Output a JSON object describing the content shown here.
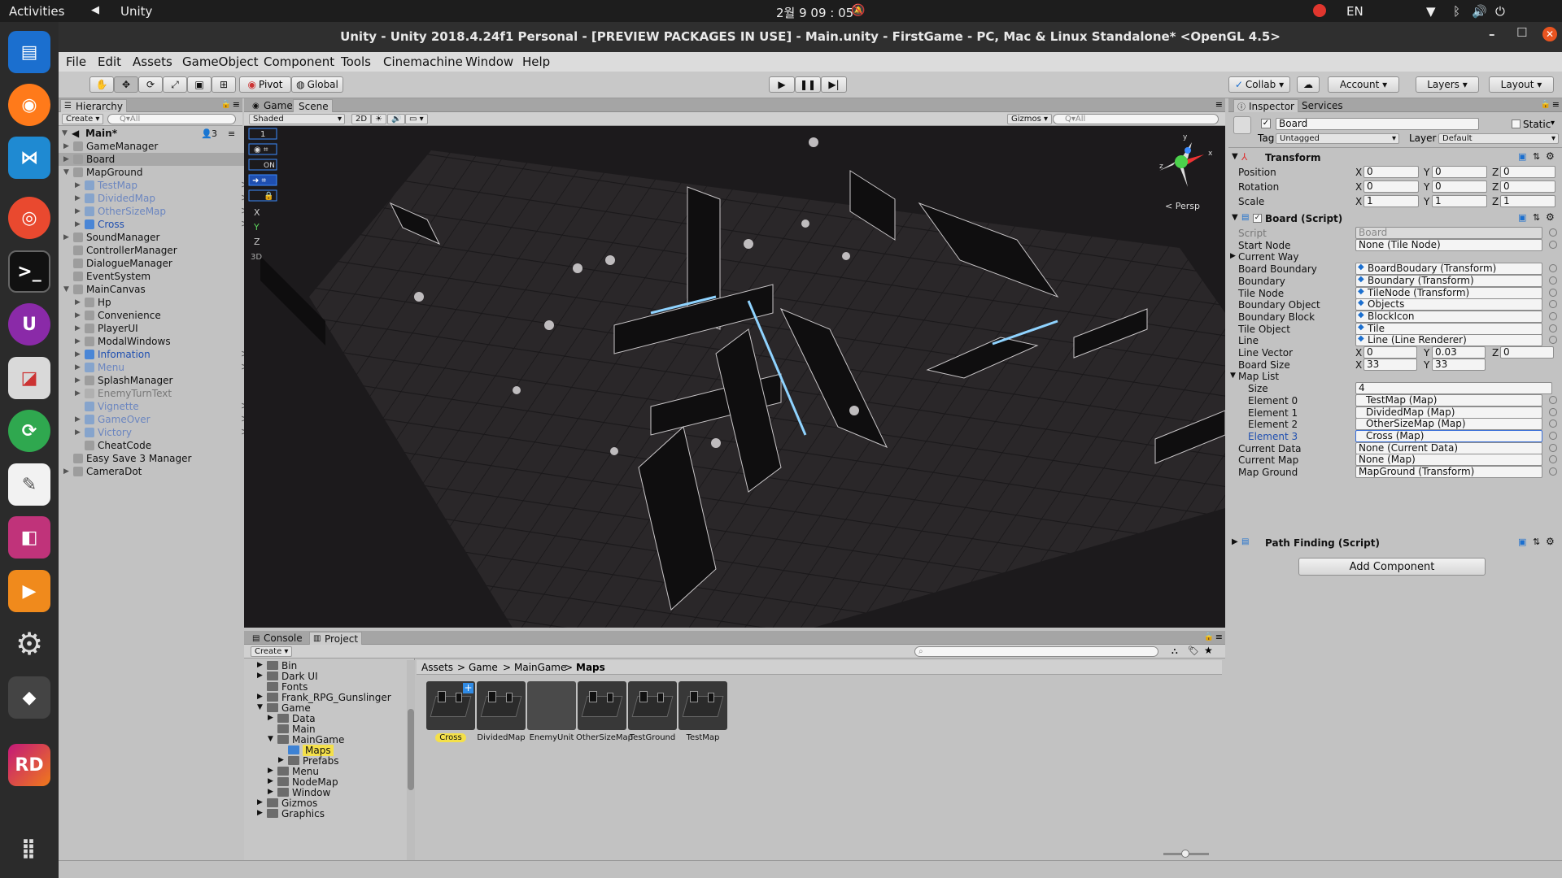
{
  "topbar": {
    "activities": "Activities",
    "app": "Unity",
    "clock": "2월 9  09 : 05",
    "lang": "EN"
  },
  "window": {
    "title": "Unity - Unity 2018.4.24f1 Personal - [PREVIEW PACKAGES IN USE] - Main.unity - FirstGame - PC, Mac & Linux Standalone* <OpenGL 4.5>"
  },
  "menu": [
    "File",
    "Edit",
    "Assets",
    "GameObject",
    "Component",
    "Tools",
    "Cinemachine",
    "Window",
    "Help"
  ],
  "toolbar": {
    "pivot": "Pivot",
    "global": "Global",
    "collab": "Collab",
    "account": "Account",
    "layers": "Layers",
    "layout": "Layout"
  },
  "hierarchy": {
    "tab": "Hierarchy",
    "create": "Create",
    "search_placeholder": "Q▾All",
    "scene": "Main*",
    "badge": "3",
    "items": [
      {
        "label": "GameManager",
        "depth": 0,
        "arrow": "right",
        "style": "normal"
      },
      {
        "label": "Board",
        "depth": 0,
        "arrow": "right",
        "style": "normal"
      },
      {
        "label": "MapGround",
        "depth": 0,
        "arrow": "down",
        "style": "normal"
      },
      {
        "label": "TestMap",
        "depth": 1,
        "arrow": "right",
        "style": "dim",
        "sub": ">"
      },
      {
        "label": "DividedMap",
        "depth": 1,
        "arrow": "right",
        "style": "dim",
        "sub": ">"
      },
      {
        "label": "OtherSizeMap",
        "depth": 1,
        "arrow": "right",
        "style": "dim",
        "sub": ">"
      },
      {
        "label": "Cross",
        "depth": 1,
        "arrow": "right",
        "style": "prefab",
        "sub": ">"
      },
      {
        "label": "SoundManager",
        "depth": 0,
        "arrow": "right",
        "style": "normal"
      },
      {
        "label": "ControllerManager",
        "depth": 0,
        "arrow": "",
        "style": "normal"
      },
      {
        "label": "DialogueManager",
        "depth": 0,
        "arrow": "",
        "style": "normal"
      },
      {
        "label": "EventSystem",
        "depth": 0,
        "arrow": "",
        "style": "normal"
      },
      {
        "label": "MainCanvas",
        "depth": 0,
        "arrow": "down",
        "style": "normal"
      },
      {
        "label": "Hp",
        "depth": 1,
        "arrow": "right",
        "style": "normal"
      },
      {
        "label": "Convenience",
        "depth": 1,
        "arrow": "right",
        "style": "normal"
      },
      {
        "label": "PlayerUI",
        "depth": 1,
        "arrow": "right",
        "style": "normal"
      },
      {
        "label": "ModalWindows",
        "depth": 1,
        "arrow": "right",
        "style": "normal"
      },
      {
        "label": "Infomation",
        "depth": 1,
        "arrow": "right",
        "style": "prefab",
        "sub": ">"
      },
      {
        "label": "Menu",
        "depth": 1,
        "arrow": "right",
        "style": "dim",
        "sub": ">"
      },
      {
        "label": "SplashManager",
        "depth": 1,
        "arrow": "right",
        "style": "normal"
      },
      {
        "label": "EnemyTurnText",
        "depth": 1,
        "arrow": "right",
        "style": "grey"
      },
      {
        "label": "Vignette",
        "depth": 1,
        "arrow": "",
        "style": "dim",
        "sub": ">"
      },
      {
        "label": "GameOver",
        "depth": 1,
        "arrow": "right",
        "style": "dim",
        "sub": ">"
      },
      {
        "label": "Victory",
        "depth": 1,
        "arrow": "right",
        "style": "dim",
        "sub": ">"
      },
      {
        "label": "CheatCode",
        "depth": 1,
        "arrow": "",
        "style": "normal"
      },
      {
        "label": "Easy Save 3 Manager",
        "depth": 0,
        "arrow": "",
        "style": "normal"
      },
      {
        "label": "CameraDot",
        "depth": 0,
        "arrow": "right",
        "style": "normal"
      }
    ]
  },
  "scene": {
    "tab_game": "Game",
    "tab_scene": "Scene",
    "shaded": "Shaded",
    "mode2d": "2D",
    "gizmos": "Gizmos",
    "search_placeholder": "Q▾All",
    "persp": "< Persp",
    "overlay": {
      "num": "1",
      "on": "ON",
      "x": "X",
      "y": "Y",
      "z": "Z",
      "d3": "3D"
    },
    "gizmo": {
      "x": "x",
      "y": "y",
      "z": "z"
    }
  },
  "inspector": {
    "tab": "Inspector",
    "services": "Services",
    "object_name": "Board",
    "static": "Static",
    "tag_label": "Tag",
    "tag_value": "Untagged",
    "layer_label": "Layer",
    "layer_value": "Default",
    "transform": {
      "title": "Transform",
      "position": "Position",
      "rotation": "Rotation",
      "scale": "Scale",
      "pos": [
        "0",
        "0",
        "0"
      ],
      "rot": [
        "0",
        "0",
        "0"
      ],
      "scl": [
        "1",
        "1",
        "1"
      ]
    },
    "board": {
      "title": "Board (Script)",
      "rows": [
        {
          "k": "Script",
          "v": "Board",
          "type": "script"
        },
        {
          "k": "Start Node",
          "v": "None (Tile Node)",
          "type": "obj"
        },
        {
          "k": "Current Way",
          "v": "",
          "type": "fold"
        },
        {
          "k": "Board Boundary",
          "v": "BoardBoudary (Transform)",
          "type": "ref"
        },
        {
          "k": "Boundary",
          "v": "Boundary (Transform)",
          "type": "ref"
        },
        {
          "k": "Tile Node",
          "v": "TileNode (Transform)",
          "type": "ref"
        },
        {
          "k": "Boundary Object",
          "v": "Objects",
          "type": "ref"
        },
        {
          "k": "Boundary Block",
          "v": "BlockIcon",
          "type": "ref"
        },
        {
          "k": "Tile Object",
          "v": "Tile",
          "type": "ref"
        },
        {
          "k": "Line",
          "v": "Line (Line Renderer)",
          "type": "ref"
        }
      ],
      "line_vector": {
        "k": "Line Vector",
        "x": "0",
        "y": "0.03",
        "z": "0"
      },
      "board_size": {
        "k": "Board Size",
        "x": "33",
        "y": "33"
      },
      "map_list": {
        "k": "Map List",
        "size_k": "Size",
        "size_v": "4",
        "elements": [
          {
            "k": "Element 0",
            "v": "TestMap (Map)"
          },
          {
            "k": "Element 1",
            "v": "DividedMap (Map)"
          },
          {
            "k": "Element 2",
            "v": "OtherSizeMap (Map)"
          },
          {
            "k": "Element 3",
            "v": "Cross (Map)"
          }
        ]
      },
      "tail": [
        {
          "k": "Current Data",
          "v": "None (Current Data)"
        },
        {
          "k": "Current Map",
          "v": "None (Map)"
        },
        {
          "k": "Map Ground",
          "v": "MapGround (Transform)"
        }
      ]
    },
    "pathfinding": "Path Finding (Script)",
    "add_component": "Add Component"
  },
  "bottom": {
    "tab_console": "Console",
    "tab_project": "Project",
    "create": "Create",
    "tree": [
      {
        "label": "Bin",
        "depth": 0,
        "arrow": "right"
      },
      {
        "label": "Dark UI",
        "depth": 0,
        "arrow": "right"
      },
      {
        "label": "Fonts",
        "depth": 0,
        "arrow": ""
      },
      {
        "label": "Frank_RPG_Gunslinger",
        "depth": 0,
        "arrow": "right"
      },
      {
        "label": "Game",
        "depth": 0,
        "arrow": "down"
      },
      {
        "label": "Data",
        "depth": 1,
        "arrow": "right"
      },
      {
        "label": "Main",
        "depth": 1,
        "arrow": ""
      },
      {
        "label": "MainGame",
        "depth": 1,
        "arrow": "down"
      },
      {
        "label": "Maps",
        "depth": 2,
        "arrow": "",
        "selected": true
      },
      {
        "label": "Prefabs",
        "depth": 2,
        "arrow": "right"
      },
      {
        "label": "Menu",
        "depth": 1,
        "arrow": "right"
      },
      {
        "label": "NodeMap",
        "depth": 1,
        "arrow": "right"
      },
      {
        "label": "Window",
        "depth": 1,
        "arrow": "right"
      },
      {
        "label": "Gizmos",
        "depth": 0,
        "arrow": "right"
      },
      {
        "label": "Graphics",
        "depth": 0,
        "arrow": "right"
      }
    ],
    "breadcrumb": [
      "Assets",
      "Game",
      "MainGame",
      "Maps"
    ],
    "assets": [
      {
        "label": "Cross",
        "selected": true
      },
      {
        "label": "DividedMap"
      },
      {
        "label": "EnemyUnit",
        "empty": true
      },
      {
        "label": "OtherSizeMap"
      },
      {
        "label": "TestGround"
      },
      {
        "label": "TestMap"
      }
    ]
  }
}
